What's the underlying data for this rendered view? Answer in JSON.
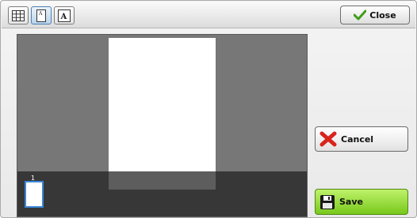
{
  "toolbar": {
    "view_buttons": [
      {
        "icon": "grid-view-icon",
        "active": false
      },
      {
        "icon": "single-page-view-icon",
        "active": true
      },
      {
        "icon": "text-page-view-icon",
        "active": false
      }
    ],
    "close_label": "Close",
    "close_icon": "checkmark-icon"
  },
  "preview": {
    "page_count": 1,
    "thumbnails": [
      {
        "number": "1"
      }
    ]
  },
  "actions": {
    "cancel_label": "Cancel",
    "cancel_icon": "red-x-icon",
    "save_label": "Save",
    "save_icon": "floppy-disk-icon"
  },
  "colors": {
    "preview_bg": "#777777",
    "thumb_strip": "#2a2a2a",
    "save_green": "#8ad32a",
    "cancel_red": "#d9231d",
    "check_green": "#3f9e1a"
  }
}
